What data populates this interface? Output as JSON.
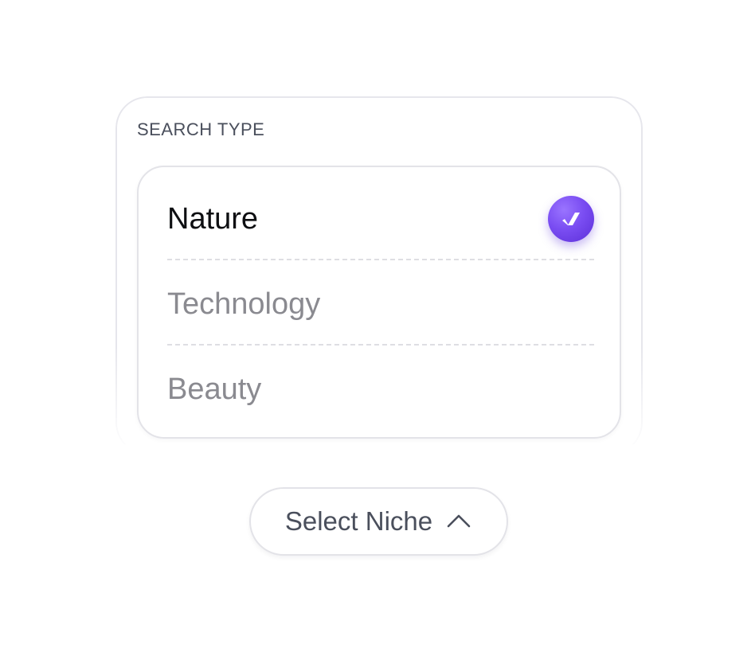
{
  "panel": {
    "label": "SEARCH TYPE"
  },
  "options": [
    {
      "label": "Nature",
      "selected": true
    },
    {
      "label": "Technology",
      "selected": false
    },
    {
      "label": "Beauty",
      "selected": false
    }
  ],
  "select_button": {
    "label": "Select Niche",
    "icon": "chevron-up-icon"
  },
  "colors": {
    "accent": "#7a4df2",
    "text_primary": "#0e0f12",
    "text_muted": "#8a8a90",
    "text_secondary": "#4a4f5c",
    "border": "#e3e3e8"
  }
}
